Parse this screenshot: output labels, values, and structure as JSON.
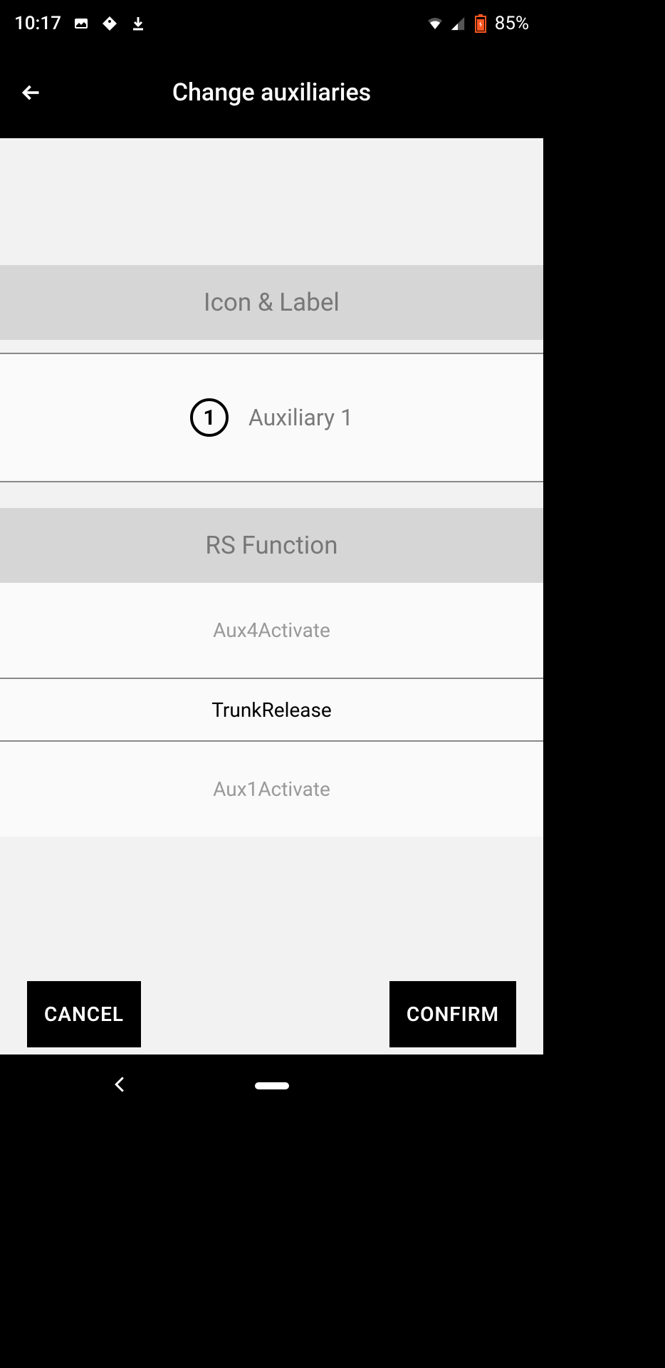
{
  "status": {
    "time": "10:17",
    "battery": "85%"
  },
  "header": {
    "title": "Change auxiliaries"
  },
  "sections": {
    "icon_label": {
      "title": "Icon & Label",
      "number": "1",
      "label": "Auxiliary 1"
    },
    "rs_function": {
      "title": "RS Function",
      "options": [
        "Aux4Activate",
        "TrunkRelease",
        "Aux1Activate"
      ]
    }
  },
  "buttons": {
    "cancel": "CANCEL",
    "confirm": "CONFIRM"
  }
}
